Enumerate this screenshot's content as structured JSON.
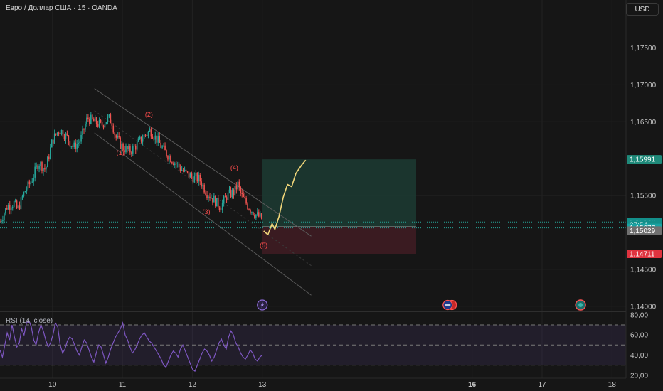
{
  "title": "Евро / Доллар США · 15 · OANDA",
  "currency_button": "USD",
  "indicator_label": "RSI (14, close)",
  "colors": {
    "background": "#161616",
    "up": "#26a69a",
    "down": "#ef5350",
    "forecast": "#f2d77a",
    "rsi": "#7e57c2",
    "target_zone": "#1c3b33",
    "stop_zone": "#3e1c22",
    "wave_label": "#ff4d4d"
  },
  "icons": [
    "lightning-event-icon",
    "us-flag-event-icon",
    "eu-event-icon"
  ],
  "chart_data": {
    "type": "candlestick",
    "title": "Евро / Доллар США · 15 · OANDA",
    "price_axis": {
      "range": [
        1.1395,
        1.1815
      ],
      "ticks": [
        {
          "v": 1.175,
          "t": "1,17500"
        },
        {
          "v": 1.17,
          "t": "1,17000"
        },
        {
          "v": 1.165,
          "t": "1,16500"
        },
        {
          "v": 1.155,
          "t": "1,15500"
        },
        {
          "v": 1.145,
          "t": "1,14500"
        },
        {
          "v": 1.14,
          "t": "1,14000"
        }
      ]
    },
    "x_axis": {
      "range": [
        9.25,
        18.2
      ],
      "ticks": [
        {
          "v": 10,
          "t": "10"
        },
        {
          "v": 11,
          "t": "11"
        },
        {
          "v": 12,
          "t": "12"
        },
        {
          "v": 13,
          "t": "13"
        },
        {
          "v": 16,
          "t": "16",
          "bold": true
        },
        {
          "v": 17,
          "t": "17"
        },
        {
          "v": 18,
          "t": "18"
        }
      ]
    },
    "price_path": [
      [
        9.25,
        1.1515
      ],
      [
        9.35,
        1.1535
      ],
      [
        9.45,
        1.154
      ],
      [
        9.5,
        1.153
      ],
      [
        9.6,
        1.1555
      ],
      [
        9.7,
        1.157
      ],
      [
        9.8,
        1.1595
      ],
      [
        9.9,
        1.1585
      ],
      [
        10.0,
        1.1625
      ],
      [
        10.1,
        1.164
      ],
      [
        10.2,
        1.163
      ],
      [
        10.3,
        1.1615
      ],
      [
        10.4,
        1.1625
      ],
      [
        10.45,
        1.164
      ],
      [
        10.5,
        1.1655
      ],
      [
        10.6,
        1.165
      ],
      [
        10.7,
        1.1645
      ],
      [
        10.8,
        1.1655
      ],
      [
        10.85,
        1.165
      ],
      [
        10.9,
        1.163
      ],
      [
        11.0,
        1.1615
      ],
      [
        11.1,
        1.161
      ],
      [
        11.2,
        1.1618
      ],
      [
        11.3,
        1.163
      ],
      [
        11.4,
        1.1638
      ],
      [
        11.5,
        1.1625
      ],
      [
        11.6,
        1.161
      ],
      [
        11.7,
        1.16
      ],
      [
        11.8,
        1.159
      ],
      [
        11.9,
        1.158
      ],
      [
        12.0,
        1.1575
      ],
      [
        12.1,
        1.1572
      ],
      [
        12.2,
        1.1555
      ],
      [
        12.3,
        1.1545
      ],
      [
        12.4,
        1.1535
      ],
      [
        12.5,
        1.155
      ],
      [
        12.6,
        1.1555
      ],
      [
        12.65,
        1.1565
      ],
      [
        12.7,
        1.155
      ],
      [
        12.8,
        1.1535
      ],
      [
        12.9,
        1.1525
      ],
      [
        13.0,
        1.1518
      ]
    ],
    "channel_lines": [
      [
        [
          10.6,
          1.1695
        ],
        [
          13.7,
          1.1495
        ]
      ],
      [
        [
          10.6,
          1.1635
        ],
        [
          13.7,
          1.1415
        ]
      ],
      [
        [
          10.6,
          1.1665
        ],
        [
          13.7,
          1.1455
        ]
      ]
    ],
    "wave_labels": [
      {
        "t": "(1)",
        "x": 10.97,
        "y": 1.1605
      },
      {
        "t": "(2)",
        "x": 11.38,
        "y": 1.1657
      },
      {
        "t": "(3)",
        "x": 12.2,
        "y": 1.1525
      },
      {
        "t": "(4)",
        "x": 12.6,
        "y": 1.1585
      },
      {
        "t": "(5)",
        "x": 13.02,
        "y": 1.148
      }
    ],
    "forecast_path": [
      [
        13.02,
        1.1502
      ],
      [
        13.08,
        1.1497
      ],
      [
        13.14,
        1.1512
      ],
      [
        13.18,
        1.1504
      ],
      [
        13.24,
        1.1522
      ],
      [
        13.3,
        1.1548
      ],
      [
        13.36,
        1.1565
      ],
      [
        13.42,
        1.1562
      ],
      [
        13.48,
        1.158
      ],
      [
        13.56,
        1.1591
      ],
      [
        13.62,
        1.1598
      ]
    ],
    "position": {
      "from": 13.0,
      "to": 15.2,
      "entry": 1.15077,
      "target": 1.15991,
      "stop": 1.14711
    },
    "price_tags": [
      {
        "t": "1,15991",
        "v": 1.15991,
        "color": "#1f8a7a"
      },
      {
        "t": "1,15142",
        "v": 1.15142,
        "color": "#138f8a"
      },
      {
        "t": "07:54",
        "v": 1.15105,
        "color": "#138f8a"
      },
      {
        "t": "1,15077",
        "v": 1.15062,
        "color": "#1aa3a3"
      },
      {
        "t": "1,15029",
        "v": 1.15025,
        "color": "#707070"
      },
      {
        "t": "1,14711",
        "v": 1.14711,
        "color": "#e0333f"
      }
    ],
    "rsi": {
      "label": "RSI (14, close)",
      "range": [
        17,
        82
      ],
      "ticks": [
        {
          "v": 80,
          "t": "80,00"
        },
        {
          "v": 60,
          "t": "60,00"
        },
        {
          "v": 40,
          "t": "40,00"
        },
        {
          "v": 20,
          "t": "20,00"
        }
      ],
      "bands": [
        30,
        50,
        70
      ],
      "values": [
        45,
        38,
        50,
        62,
        55,
        70,
        58,
        48,
        52,
        66,
        60,
        72,
        74,
        68,
        55,
        50,
        62,
        70,
        64,
        55,
        48,
        52,
        60,
        72,
        68,
        50,
        42,
        46,
        54,
        58,
        56,
        50,
        44,
        40,
        48,
        55,
        52,
        45,
        38,
        33,
        42,
        50,
        48,
        40,
        32,
        38,
        46,
        52,
        58,
        62,
        66,
        72,
        60,
        55,
        48,
        42,
        45,
        50,
        56,
        60,
        62,
        58,
        54,
        52,
        48,
        44,
        40,
        36,
        30,
        28,
        34,
        40,
        44,
        42,
        38,
        46,
        50,
        44,
        38,
        32,
        26,
        24,
        30,
        36,
        42,
        46,
        44,
        40,
        34,
        38,
        45,
        52,
        56,
        50,
        46,
        58,
        64,
        60,
        52,
        48,
        42,
        38,
        36,
        40,
        45,
        42,
        36,
        34,
        38,
        40
      ]
    },
    "event_icons": [
      {
        "icon": "lightning-event-icon",
        "x": 13.0
      },
      {
        "icon": "us-flag-event-icon",
        "x": 15.65
      },
      {
        "icon": "eu-event-icon",
        "x": 17.55
      }
    ]
  }
}
